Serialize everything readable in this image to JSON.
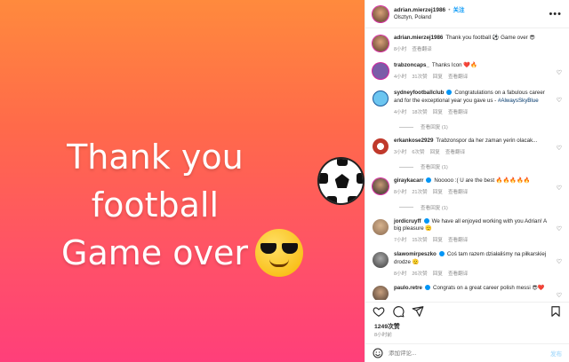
{
  "media": {
    "line1": "Thank you football",
    "line1_emoji": "soccer-ball",
    "line2": "Game over",
    "line2_emoji": "sunglasses-face",
    "gradient_top": "#ff8a3d",
    "gradient_bottom": "#ff3f7a"
  },
  "header": {
    "username": "adrian.mierzej1986",
    "separator": "•",
    "follow_label": "关注",
    "location": "Olsztyn, Poland",
    "more": "•••"
  },
  "caption": {
    "username": "adrian.mierzej1986",
    "text": "Thank you football ⚽ Game over 😎",
    "time": "8小时",
    "translate": "查看翻译"
  },
  "comments": [
    {
      "user": "trabzoncaps_",
      "text": "Thanks Icon ❤️🔥",
      "time": "4小时",
      "likes": "31次赞",
      "reply": "回复",
      "translate": "查看翻译",
      "verified": false
    },
    {
      "user": "sydneyfootballclub",
      "text": "Congratulations on a fabulous career and for the exceptional year you gave us - ",
      "tag": "#AlwaysSkyBlue",
      "time": "4小时",
      "likes": "18次赞",
      "reply": "回复",
      "translate": "查看翻译",
      "verified": true,
      "replies": "查看回复 (1)"
    },
    {
      "user": "erkankose2929",
      "text": "Trabzonspor da her zaman yerin olacak...",
      "time": "3小时",
      "likes": "6次赞",
      "reply": "回复",
      "translate": "查看翻译",
      "verified": false,
      "replies": "查看回复 (1)"
    },
    {
      "user": "giraykacarr",
      "text": "Nooooo :( U are the best 🔥🔥🔥🔥🔥",
      "time": "8小时",
      "likes": "21次赞",
      "reply": "回复",
      "translate": "查看翻译",
      "verified": true,
      "replies": "查看回复 (1)"
    },
    {
      "user": "jordicruyff",
      "text": "We have all enjoyed working with you Adrian! A big pleasure 🫡",
      "time": "7小时",
      "likes": "15次赞",
      "reply": "回复",
      "translate": "查看翻译",
      "verified": true
    },
    {
      "user": "slawomirpeszko",
      "text": "Coś tam razem działaliśmy na piłkarskiej drodze 🫡",
      "time": "8小时",
      "likes": "26次赞",
      "reply": "回复",
      "translate": "查看翻译",
      "verified": true
    },
    {
      "user": "paulo.retre",
      "text": "Congrats on a great career polish messi 😎❤️",
      "time": "",
      "likes": "",
      "reply": "",
      "translate": "",
      "verified": true
    }
  ],
  "footer": {
    "likes": "1249次赞",
    "time": "8小时前",
    "comment_placeholder": "添加评论...",
    "post_label": "发布"
  },
  "icons": {
    "like": "heart-icon",
    "comment": "comment-icon",
    "share": "share-icon",
    "save": "bookmark-icon",
    "emoji": "emoji-icon"
  }
}
